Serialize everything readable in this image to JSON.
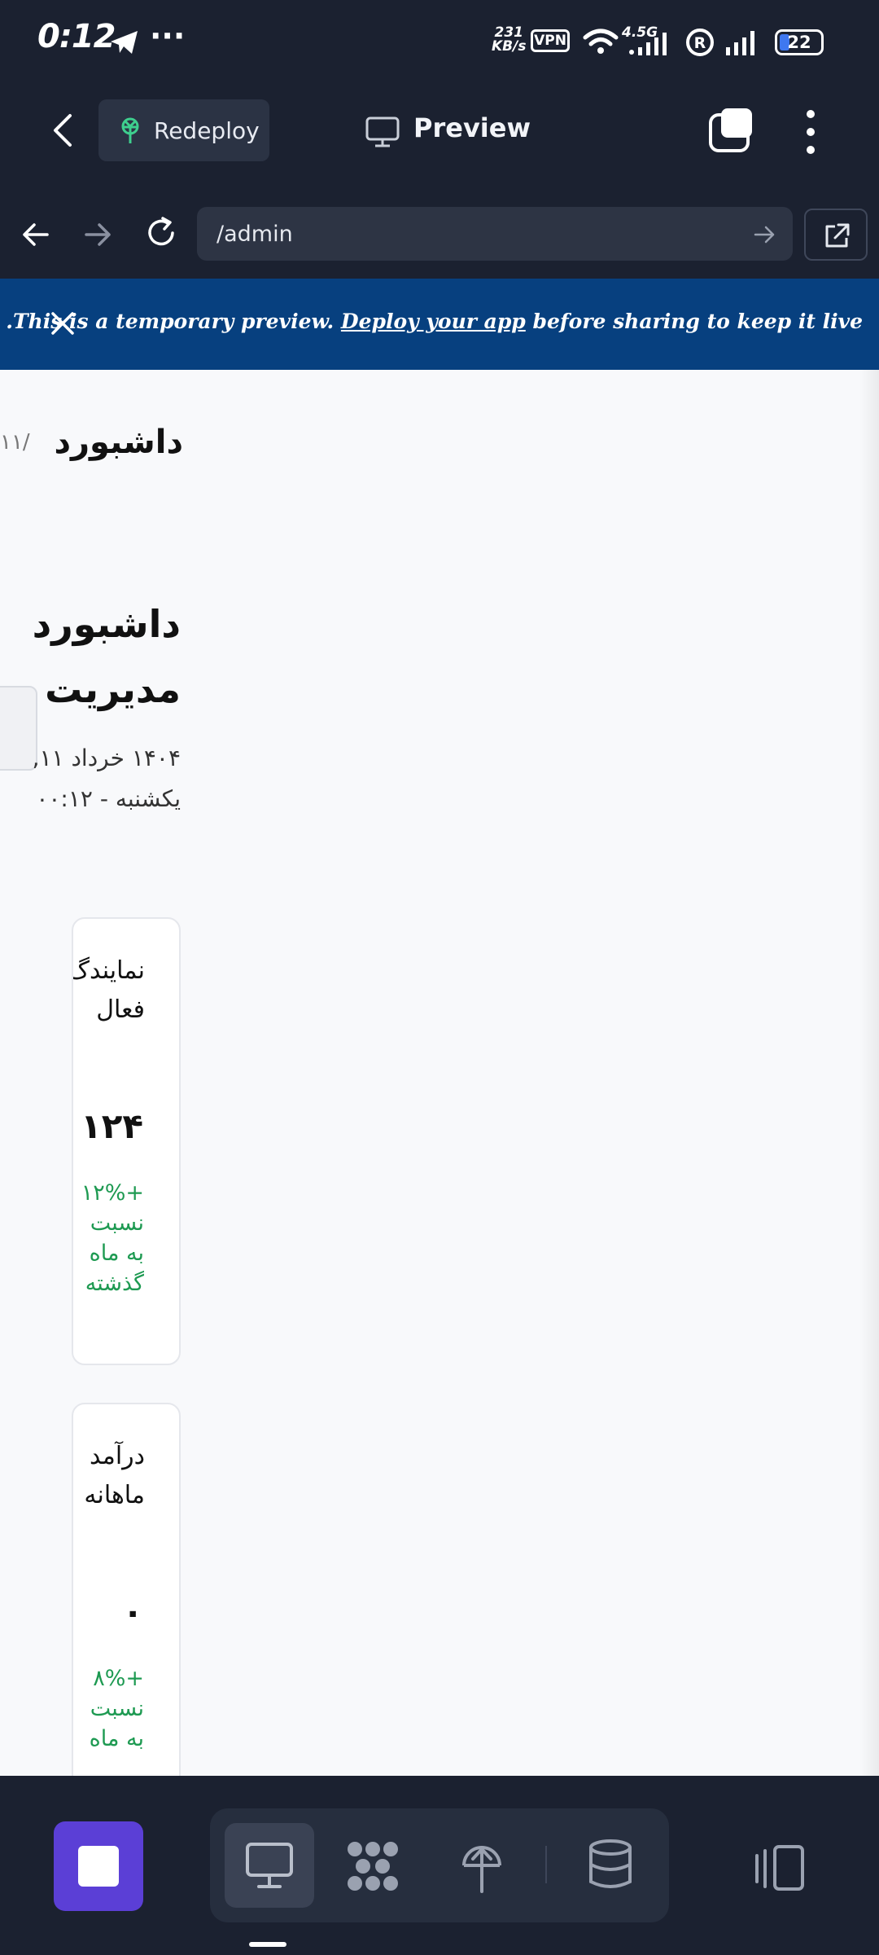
{
  "status_bar": {
    "time": "0:12",
    "dots": "···",
    "speed_value": "231",
    "speed_unit": "KB/s",
    "vpn": "VPN",
    "network": "4.5G",
    "battery": "22"
  },
  "header": {
    "redeploy_label": "Redeploy",
    "preview_label": "Preview"
  },
  "address_bar": {
    "url": "/admin"
  },
  "banner": {
    "text_before": ".This is a temporary preview. ",
    "link_text": "Deploy your app",
    "text_after": " before sharing to keep it live"
  },
  "page": {
    "brand": "داشبورد",
    "edge_number": "۱۱/",
    "title": "داشبورد مدیریت",
    "date_line": "۱۴۰۴ خرداد ۱۱, یکشنبه - ۰۰:۱۲",
    "cards": [
      {
        "label": "نمایندگ فعال",
        "value": "۱۲۴",
        "change": "+۱۲% نسبت به ماه گذشته"
      },
      {
        "label": "درآمد ماهانه",
        "value": "۰",
        "change": "+۸% نسبت به ماه"
      }
    ]
  },
  "colors": {
    "dark_bg": "#1b2130",
    "banner_bg": "#07407f",
    "accent_purple": "#5b3fd6",
    "positive_green": "#1e9a52",
    "redeploy_icon": "#3ecf8e"
  }
}
